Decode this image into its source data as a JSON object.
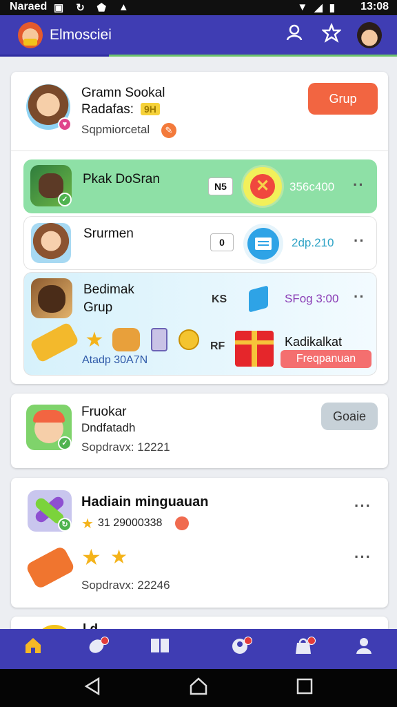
{
  "status_bar": {
    "carrier": "Naraed",
    "time": "13:08"
  },
  "app_bar": {
    "title": "Elmosciei"
  },
  "profile_card": {
    "name": "Gramn Sookal",
    "subtitle": "Radafas:",
    "badge": "9H",
    "status": "Sqpmiorcetal",
    "action_label": "Grup"
  },
  "rows": [
    {
      "name": "Pkak DoSran",
      "code": "N5",
      "amount": "356c400",
      "bg": "#8ee0a6"
    },
    {
      "name": "Srurmen",
      "code": "0",
      "amount": "2dp.210",
      "bg": "#ffffff"
    },
    {
      "name": "Bedimak",
      "name2": "Grup",
      "code": "KS",
      "amount": "SFog 3:00",
      "bg": "#dff4fb"
    }
  ],
  "reward_section": {
    "caption": "Atadp 30A7N",
    "code": "RF",
    "title": "Kadikalkat",
    "tag": "Freqpanuan"
  },
  "group_card": {
    "name": "Fruokar",
    "subtitle": "Dndfatadh",
    "meta": "Sopdravx: 12221",
    "action_label": "Goaie"
  },
  "achievement_card": {
    "title": "Hadiain minguauan",
    "score": "31 29000338",
    "meta": "Sopdravx: 22246"
  },
  "partial_card": {
    "title": "l d"
  },
  "colors": {
    "primary": "#3f3db3",
    "accent_orange": "#f26541",
    "green": "#8ee0a6",
    "tag_red": "#f46f6f"
  }
}
